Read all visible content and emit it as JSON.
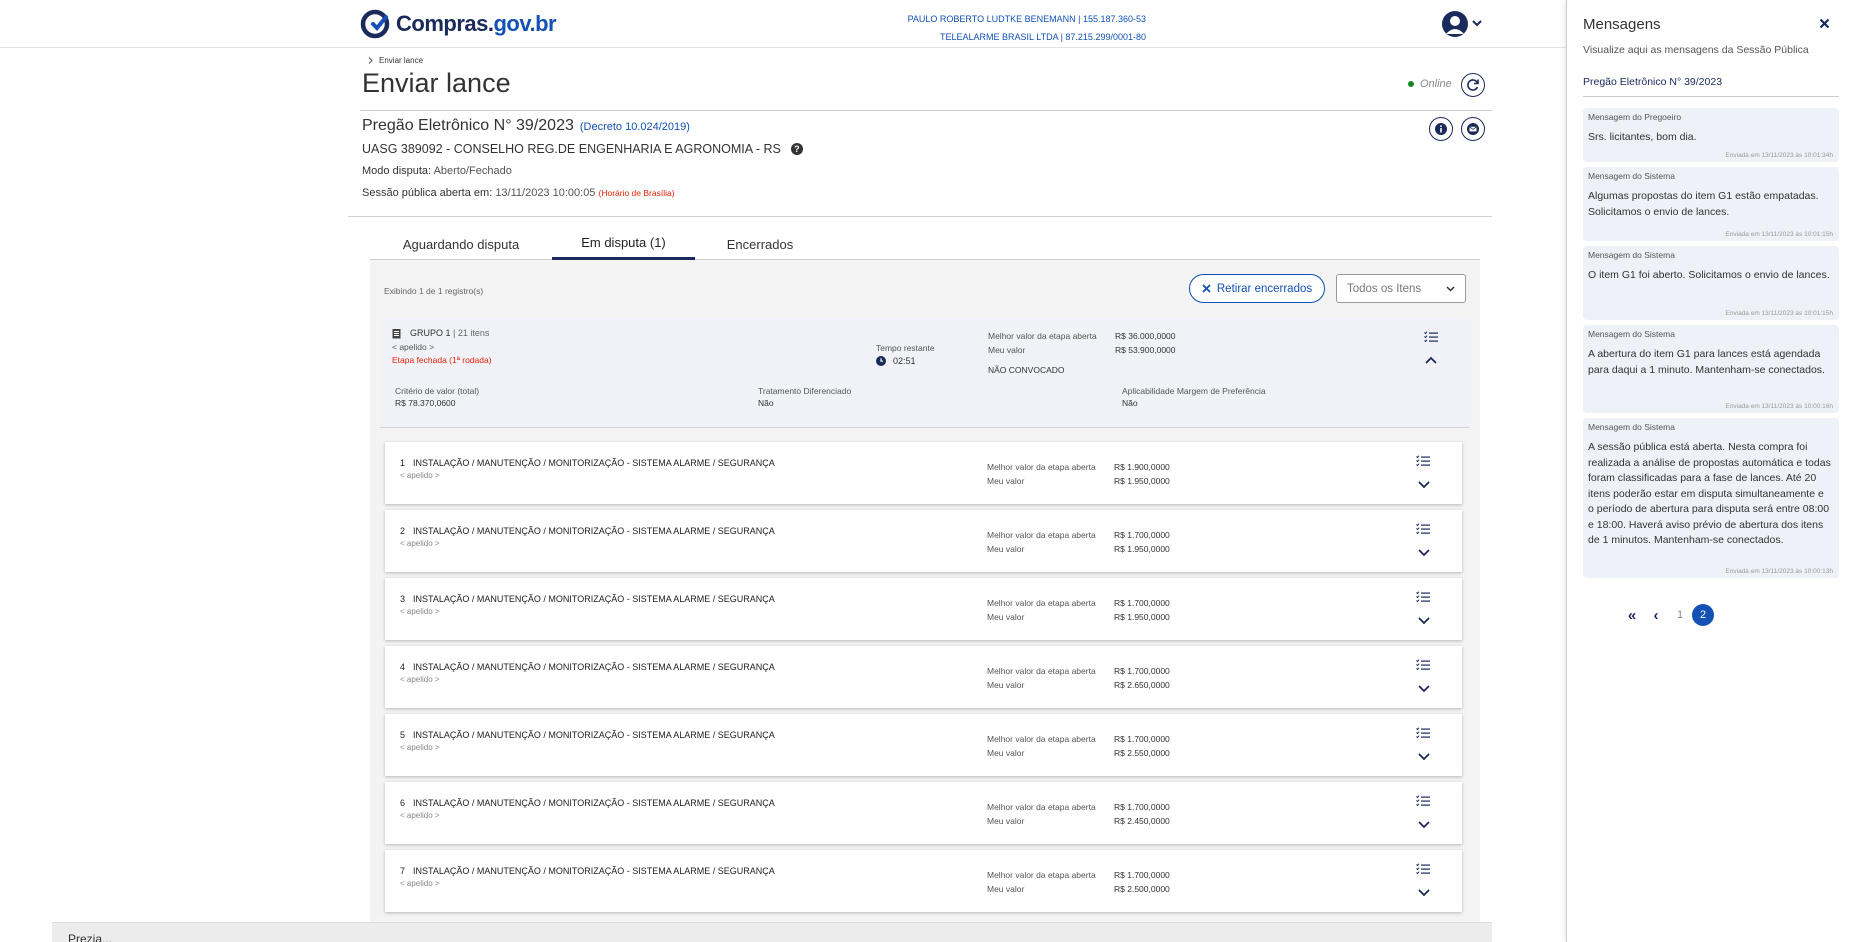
{
  "header": {
    "logo_text_main": "Compras.",
    "logo_text_gov": "gov.br",
    "user_name": "PAULO ROBERTO LUDTKE BENEMANN | 155.187.360-53",
    "company": "TELEALARME BRASIL LTDA | 87.215.299/0001-80"
  },
  "breadcrumb": {
    "current": "Enviar lance"
  },
  "page": {
    "title": "Enviar lance",
    "online_label": "Online"
  },
  "pregao": {
    "title": "Pregão Eletrônico N° 39/2023",
    "decreto": "(Decreto 10.024/2019)",
    "uasg": "UASG 389092 - CONSELHO REG.DE ENGENHARIA E AGRONOMIA - RS",
    "modo_label": "Modo disputa:",
    "modo_value": "Aberto/Fechado",
    "sessao_label": "Sessão pública aberta em:",
    "sessao_value": "13/11/2023 10:00:05",
    "horario": "(Horário de Brasília)"
  },
  "tabs": [
    {
      "label": "Aguardando disputa"
    },
    {
      "label": "Em disputa (1)"
    },
    {
      "label": "Encerrados"
    }
  ],
  "toolbar": {
    "records": "Exibindo 1 de 1 registro(s)",
    "retirar_label": "Retirar encerrados",
    "filter_value": "Todos os Itens"
  },
  "group": {
    "title": "GRUPO 1",
    "count": "| 21 itens",
    "apelido": "< apelido >",
    "etapa": "Etapa fechada (1ª rodada)",
    "tempo_label": "Tempo restante",
    "tempo_value": "02:51",
    "melhor_label": "Melhor valor da etapa aberta",
    "melhor_value": "R$ 36.000,0000",
    "meu_label": "Meu valor",
    "meu_value": "R$ 53.900,0000",
    "status": "NÃO CONVOCADO",
    "criterio_label": "Critério de valor (total)",
    "criterio_value": "R$ 78.370,0600",
    "tratamento_label": "Tratamento Diferenciado",
    "tratamento_value": "Não",
    "margem_label": "Aplicabilidade Margem de Preferência",
    "margem_value": "Não"
  },
  "item_labels": {
    "melhor": "Melhor valor da etapa aberta",
    "meu": "Meu valor",
    "apelido": "< apelido >"
  },
  "items": [
    {
      "num": "1",
      "desc": "INSTALAÇÃO / MANUTENÇÃO / MONITORIZAÇÃO - SISTEMA ALARME / SEGURANÇA",
      "melhor": "R$ 1.900,0000",
      "meu": "R$ 1.950,0000"
    },
    {
      "num": "2",
      "desc": "INSTALAÇÃO / MANUTENÇÃO / MONITORIZAÇÃO - SISTEMA ALARME / SEGURANÇA",
      "melhor": "R$ 1.700,0000",
      "meu": "R$ 1.950,0000"
    },
    {
      "num": "3",
      "desc": "INSTALAÇÃO / MANUTENÇÃO / MONITORIZAÇÃO - SISTEMA ALARME / SEGURANÇA",
      "melhor": "R$ 1.700,0000",
      "meu": "R$ 1.950,0000"
    },
    {
      "num": "4",
      "desc": "INSTALAÇÃO / MANUTENÇÃO / MONITORIZAÇÃO - SISTEMA ALARME / SEGURANÇA",
      "melhor": "R$ 1.700,0000",
      "meu": "R$ 2.650,0000"
    },
    {
      "num": "5",
      "desc": "INSTALAÇÃO / MANUTENÇÃO / MONITORIZAÇÃO - SISTEMA ALARME / SEGURANÇA",
      "melhor": "R$ 1.700,0000",
      "meu": "R$ 2.550,0000"
    },
    {
      "num": "6",
      "desc": "INSTALAÇÃO / MANUTENÇÃO / MONITORIZAÇÃO - SISTEMA ALARME / SEGURANÇA",
      "melhor": "R$ 1.700,0000",
      "meu": "R$ 2.450,0000"
    },
    {
      "num": "7",
      "desc": "INSTALAÇÃO / MANUTENÇÃO / MONITORIZAÇÃO - SISTEMA ALARME / SEGURANÇA",
      "melhor": "R$ 1.700,0000",
      "meu": "R$ 2.500,0000"
    }
  ],
  "cookie_text": "Prezia...",
  "messages_panel": {
    "title": "Mensagens",
    "subtitle": "Visualize aqui as mensagens da Sessão Pública",
    "pregao": "Pregão Eletrônico N° 39/2023",
    "messages": [
      {
        "from": "Mensagem do Pregoeiro",
        "text": "Srs. licitantes, bom dia.",
        "time": "Enviada em 13/11/2023 às 10:01:34h"
      },
      {
        "from": "Mensagem do Sistema",
        "text": "Algumas propostas do item G1 estão empatadas. Solicitamos o envio de lances.",
        "time": "Enviada em 13/11/2023 às 10:01:15h"
      },
      {
        "from": "Mensagem do Sistema",
        "text": "O item G1 foi aberto. Solicitamos o envio de lances.",
        "time": "Enviada em 13/11/2023 às 10:01:15h"
      },
      {
        "from": "Mensagem do Sistema",
        "text": "A abertura do item G1 para lances está agendada para daqui a 1 minuto. Mantenham-se conectados.",
        "time": "Enviada em 13/11/2023 às 10:00:16h"
      },
      {
        "from": "Mensagem do Sistema",
        "text": "A sessão pública está aberta. Nesta compra foi realizada a análise de propostas automática e todas foram classificadas para a fase de lances. Até 20 itens poderão estar em disputa simultaneamente e o período de abertura para disputa será entre 08:00 e 18:00. Haverá aviso prévio de abertura dos itens de 1 minutos. Mantenham-se conectados.",
        "time": "Enviada em 13/11/2023 às 10:00:13h"
      }
    ],
    "pager": {
      "first": "«",
      "prev": "‹",
      "page1": "1",
      "page2": "2"
    }
  },
  "colors": {
    "brand": "#1351b4",
    "navy": "#1a2a5a",
    "alert": "#e52207",
    "online": "#168821"
  },
  "icons": [
    "logo-icon",
    "user-avatar-icon",
    "chevron-down-icon",
    "refresh-icon",
    "info-icon",
    "mail-icon",
    "help-icon",
    "close-icon",
    "clock-icon",
    "clipboard-icon",
    "list-icon",
    "chevron-up-icon"
  ]
}
